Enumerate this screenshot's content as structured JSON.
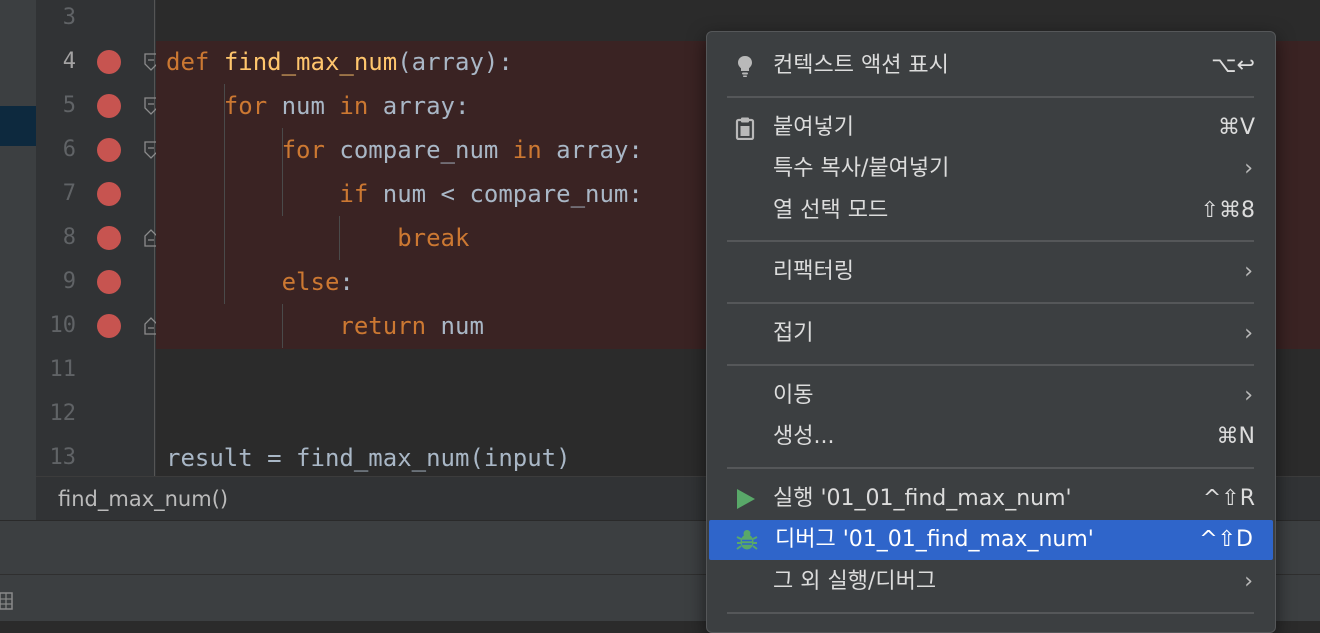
{
  "editor": {
    "line_numbers": [
      "3",
      "4",
      "5",
      "6",
      "7",
      "8",
      "9",
      "10",
      "11",
      "12",
      "13"
    ],
    "breakpoint_lines": [
      "4",
      "5",
      "6",
      "7",
      "8",
      "9",
      "10"
    ],
    "lines": [
      {
        "tokens": []
      },
      {
        "tokens": [
          {
            "t": "def",
            "c": "kw"
          },
          {
            "t": " "
          },
          {
            "t": "find_max_num",
            "c": "fn"
          },
          {
            "t": "(array):"
          }
        ]
      },
      {
        "tokens": [
          {
            "t": "    "
          },
          {
            "t": "for",
            "c": "kw"
          },
          {
            "t": " num "
          },
          {
            "t": "in",
            "c": "kw"
          },
          {
            "t": " array:"
          }
        ]
      },
      {
        "tokens": [
          {
            "t": "        "
          },
          {
            "t": "for",
            "c": "kw"
          },
          {
            "t": " compare_num "
          },
          {
            "t": "in",
            "c": "kw"
          },
          {
            "t": " array:"
          }
        ]
      },
      {
        "tokens": [
          {
            "t": "            "
          },
          {
            "t": "if",
            "c": "kw"
          },
          {
            "t": " num < compare_num:"
          }
        ]
      },
      {
        "tokens": [
          {
            "t": "                "
          },
          {
            "t": "break",
            "c": "kw"
          }
        ]
      },
      {
        "tokens": [
          {
            "t": "        "
          },
          {
            "t": "else",
            "c": "kw"
          },
          {
            "t": ":"
          }
        ]
      },
      {
        "tokens": [
          {
            "t": "            "
          },
          {
            "t": "return",
            "c": "kw"
          },
          {
            "t": " num"
          }
        ]
      },
      {
        "tokens": []
      },
      {
        "tokens": []
      },
      {
        "tokens": [
          {
            "t": "result = find_max_num(input)"
          }
        ]
      }
    ]
  },
  "breadcrumb": {
    "text": "find_max_num()"
  },
  "context_menu": {
    "items": [
      {
        "label": "컨텍스트 액션 표시",
        "shortcut": "⌥↩",
        "icon": "lightbulb-icon"
      },
      {
        "separator": true
      },
      {
        "label": "붙여넣기",
        "shortcut": "⌘V",
        "icon": "clipboard-icon"
      },
      {
        "label": "특수 복사/붙여넣기",
        "submenu": true
      },
      {
        "label": "열 선택 모드",
        "shortcut": "⇧⌘8"
      },
      {
        "separator": true
      },
      {
        "label": "리팩터링",
        "submenu": true
      },
      {
        "separator": true
      },
      {
        "label": "접기",
        "submenu": true
      },
      {
        "separator": true
      },
      {
        "label": "이동",
        "submenu": true
      },
      {
        "label": "생성...",
        "shortcut": "⌘N"
      },
      {
        "separator": true
      },
      {
        "label": "실행 '01_01_find_max_num'",
        "shortcut": "^⇧R",
        "icon": "run-icon"
      },
      {
        "label": "디버그 '01_01_find_max_num'",
        "shortcut": "^⇧D",
        "icon": "debug-icon",
        "selected": true
      },
      {
        "label": "그 외 실행/디버그",
        "submenu": true
      },
      {
        "separator": true
      }
    ]
  },
  "colors": {
    "editor_bg": "#2b2b2b",
    "breakpoint": "#c75450",
    "breakpoint_line_bg": "#3a2323",
    "keyword": "#cc7832",
    "function_name": "#ffc66d",
    "menu_bg": "#3c3f41",
    "menu_selection": "#2f65ca",
    "run_green": "#59a869",
    "debug_green": "#59a869"
  }
}
